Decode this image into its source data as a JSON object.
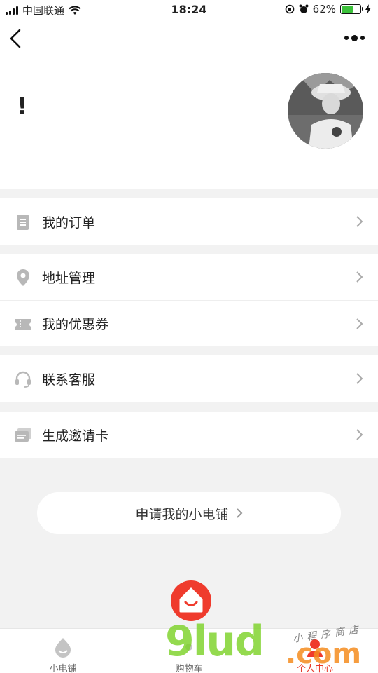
{
  "status_bar": {
    "carrier": "中国联通",
    "time": "18:24",
    "battery_percent": "62%",
    "battery_level": 0.62
  },
  "profile": {
    "name": "!"
  },
  "menu": {
    "orders": "我的订单",
    "address": "地址管理",
    "coupons": "我的优惠券",
    "support": "联系客服",
    "invite_card": "生成邀请卡"
  },
  "apply_button": "申请我的小电铺",
  "tabs": [
    {
      "label": "小电铺",
      "icon": "store-drop-icon"
    },
    {
      "label": "购物车",
      "icon": "cart-icon"
    },
    {
      "label": "个人中心",
      "icon": "person-icon"
    }
  ],
  "watermark": {
    "main": "9lud",
    "sub": "小程序商店",
    "domain": ".com"
  },
  "colors": {
    "accent": "#ef3b2d",
    "battery": "#3cc13b",
    "icon_gray": "#b8b8b8"
  }
}
